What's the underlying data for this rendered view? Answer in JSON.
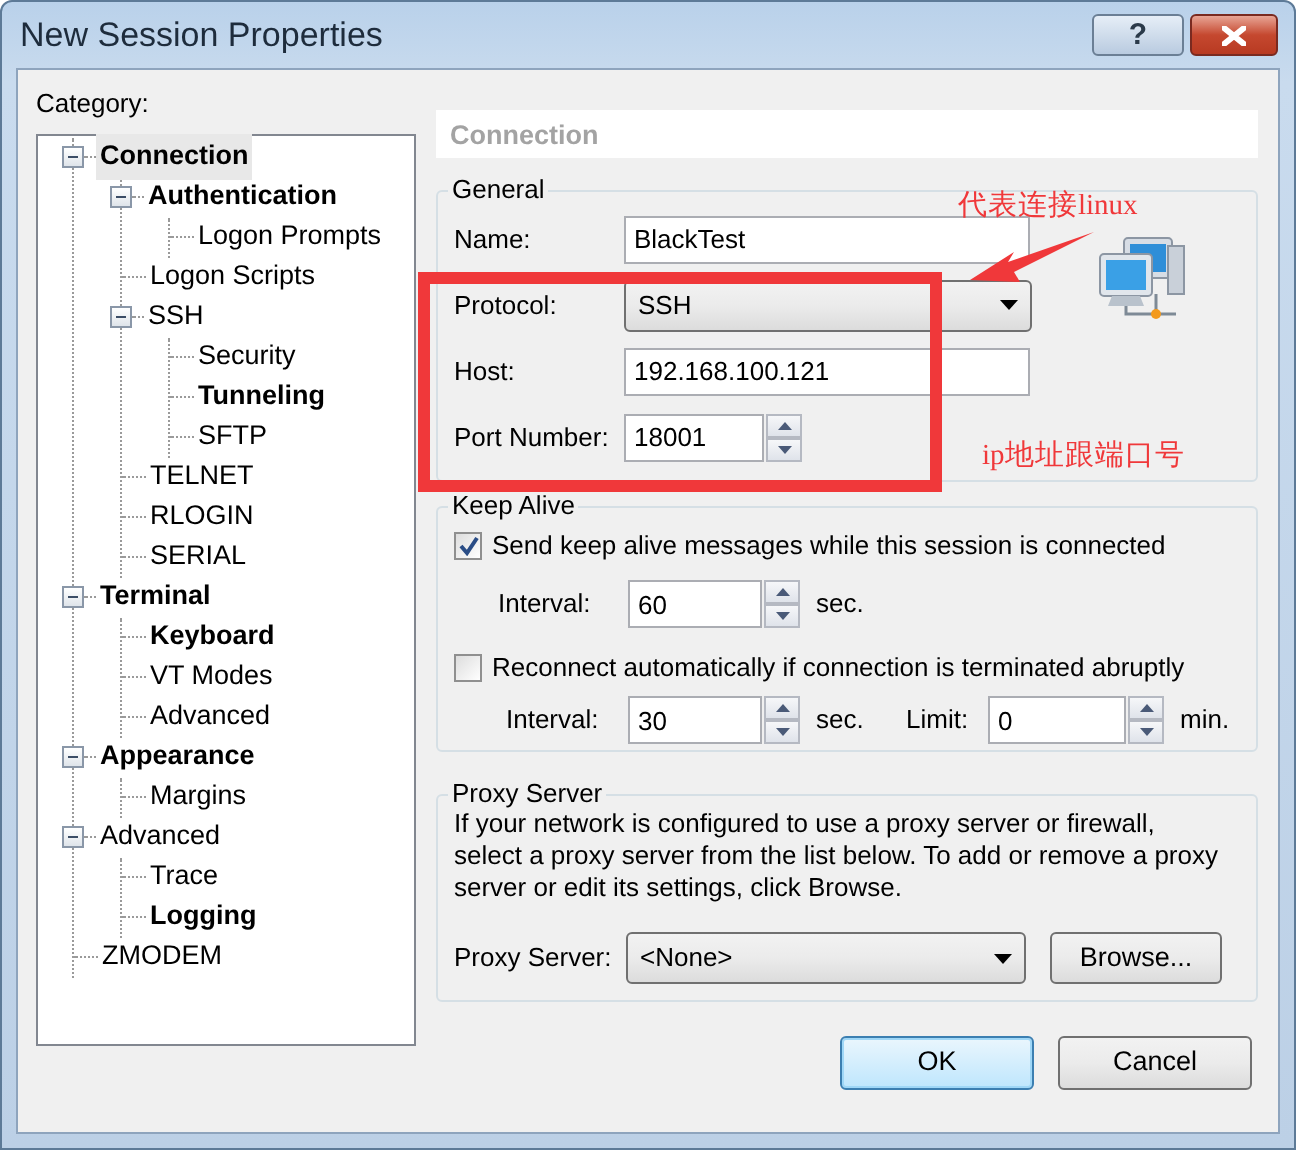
{
  "window": {
    "title": "New Session Properties",
    "help_button": "?"
  },
  "category": {
    "label": "Category:",
    "tree": [
      {
        "label": "Connection",
        "bold": true,
        "selected": true,
        "expanded": true,
        "children": [
          {
            "label": "Authentication",
            "bold": true,
            "selected": false,
            "expanded": true,
            "children": [
              {
                "label": "Logon Prompts",
                "bold": false,
                "selected": false
              }
            ]
          },
          {
            "label": "Logon Scripts",
            "bold": false,
            "selected": false
          },
          {
            "label": "SSH",
            "bold": false,
            "selected": false,
            "expanded": true,
            "children": [
              {
                "label": "Security",
                "bold": false,
                "selected": false
              },
              {
                "label": "Tunneling",
                "bold": true,
                "selected": false
              },
              {
                "label": "SFTP",
                "bold": false,
                "selected": false
              }
            ]
          },
          {
            "label": "TELNET",
            "bold": false,
            "selected": false
          },
          {
            "label": "RLOGIN",
            "bold": false,
            "selected": false
          },
          {
            "label": "SERIAL",
            "bold": false,
            "selected": false
          }
        ]
      },
      {
        "label": "Terminal",
        "bold": true,
        "selected": false,
        "expanded": true,
        "children": [
          {
            "label": "Keyboard",
            "bold": true,
            "selected": false
          },
          {
            "label": "VT Modes",
            "bold": false,
            "selected": false
          },
          {
            "label": "Advanced",
            "bold": false,
            "selected": false
          }
        ]
      },
      {
        "label": "Appearance",
        "bold": true,
        "selected": false,
        "expanded": true,
        "children": [
          {
            "label": "Margins",
            "bold": false,
            "selected": false
          }
        ]
      },
      {
        "label": "Advanced",
        "bold": false,
        "selected": false,
        "expanded": true,
        "children": [
          {
            "label": "Trace",
            "bold": false,
            "selected": false
          },
          {
            "label": "Logging",
            "bold": true,
            "selected": false
          }
        ]
      },
      {
        "label": "ZMODEM",
        "bold": false,
        "selected": false
      }
    ]
  },
  "panel": {
    "title": "Connection",
    "general": {
      "legend": "General",
      "fields": [
        {
          "kind": "text",
          "label": "Name:",
          "value": "BlackTest"
        },
        {
          "kind": "select",
          "label": "Protocol:",
          "value": "SSH"
        },
        {
          "kind": "text",
          "label": "Host:",
          "value": "192.168.100.121"
        },
        {
          "kind": "spin",
          "label": "Port Number:",
          "value": "18001"
        }
      ]
    },
    "keep_alive": {
      "legend": "Keep Alive",
      "options": [
        {
          "label": "Send keep alive messages while this session is connected",
          "checked": true,
          "fields": [
            {
              "label": "Interval:",
              "value": "60",
              "unit": "sec."
            }
          ]
        },
        {
          "label": "Reconnect automatically if connection is terminated abruptly",
          "checked": false,
          "fields": [
            {
              "label": "Interval:",
              "value": "30",
              "unit": "sec."
            },
            {
              "label": "Limit:",
              "value": "0",
              "unit": "min."
            }
          ]
        }
      ]
    },
    "proxy": {
      "legend": "Proxy Server",
      "description": "If your network is configured to use a proxy server or firewall, select a proxy server from the list below. To add or remove a proxy server or edit its settings, click Browse.",
      "label": "Proxy Server:",
      "value": "<None>",
      "browse": "Browse..."
    }
  },
  "buttons": [
    {
      "label": "OK",
      "default": true
    },
    {
      "label": "Cancel",
      "default": false
    }
  ],
  "annotations": {
    "protocol_note": "代表连接linux",
    "address_note": "ip地址跟端口号"
  }
}
